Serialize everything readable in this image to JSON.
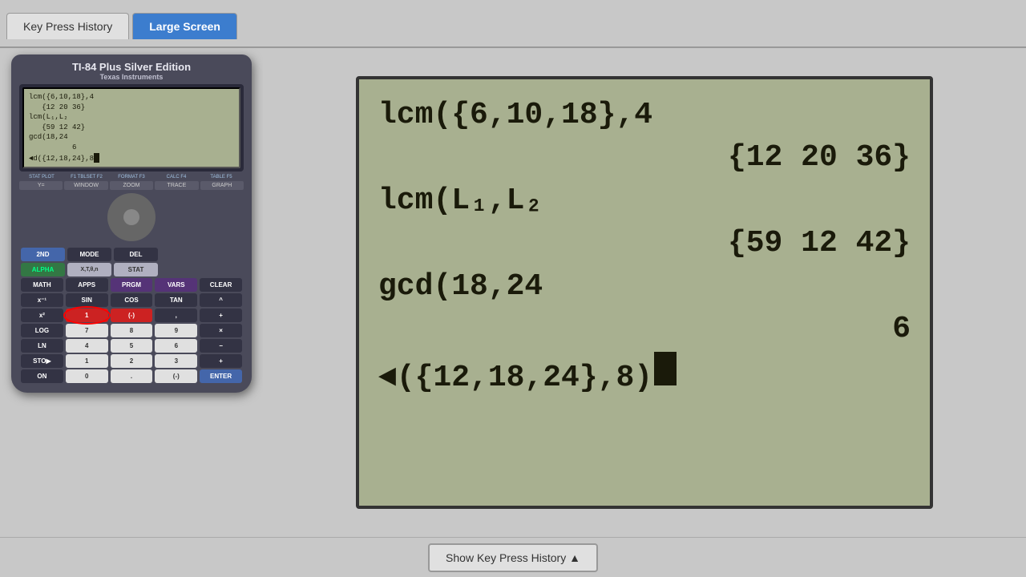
{
  "tabs": [
    {
      "id": "key-press-history",
      "label": "Key Press History",
      "active": false
    },
    {
      "id": "large-screen",
      "label": "Large Screen",
      "active": true
    }
  ],
  "calculator": {
    "model": "TI-84 Plus Silver Edition",
    "brand": "Texas Instruments",
    "screen_lines": [
      "lcm({6,10,18},4",
      "    {12 20 36}",
      "lcm(L₁,L₂",
      "    {59 12 42}",
      "gcd(18,24",
      "               6",
      "◄d({12,18,24},8▌"
    ]
  },
  "large_screen": {
    "lines": [
      {
        "text": "lcm({6,10,18},4",
        "indent": false
      },
      {
        "text": "{12 20 36}",
        "indent": true
      },
      {
        "text": "lcm(L₁,L₂",
        "indent": false
      },
      {
        "text": "{59 12 42}",
        "indent": true
      },
      {
        "text": "gcd(18,24",
        "indent": false
      },
      {
        "text": "6",
        "indent": true
      },
      {
        "text": "◄({12,18,24},8)▌",
        "indent": false
      }
    ]
  },
  "bottom_bar": {
    "show_history_btn": "Show Key Press History ▲"
  },
  "buttons": {
    "row1": [
      "2ND",
      "MODE",
      "DEL"
    ],
    "row2": [
      "ALPHA",
      "X,T,θ,n",
      "STAT"
    ],
    "row3": [
      "MATH",
      "APPS",
      "PRGM",
      "VARS",
      "CLEAR"
    ],
    "row4": [
      "x⁻¹",
      "SIN",
      "COS",
      "TAN",
      "^"
    ],
    "row5": [
      "x²",
      "",
      "",
      "",
      "+"
    ],
    "row6": [
      "LOG",
      "7",
      "8",
      "9",
      "×"
    ],
    "row7": [
      "LN",
      "4",
      "5",
      "6",
      "−"
    ],
    "row8": [
      "STO▶",
      "1",
      "2",
      "3",
      "+"
    ],
    "row9": [
      "ON",
      "0",
      ".",
      "(-)",
      "ENTER"
    ]
  }
}
